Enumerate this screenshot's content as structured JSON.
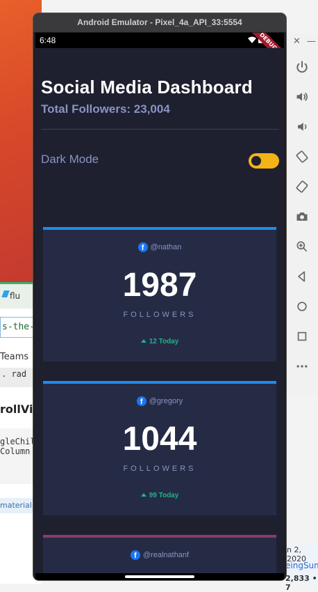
{
  "emulator": {
    "title": "Android Emulator - Pixel_4a_API_33:5554",
    "status_time": "6:48",
    "debug_banner": "DEBUG"
  },
  "dashboard": {
    "title": "Social Media Dashboard",
    "total_followers": "Total Followers: 23,004",
    "dark_mode_label": "Dark Mode",
    "dark_mode_on": true,
    "cards": [
      {
        "network": "facebook",
        "handle": "@nathan",
        "count": "1987",
        "label": "FOLLOWERS",
        "today": "12 Today",
        "accent": "#1d8cf0"
      },
      {
        "network": "facebook",
        "handle": "@gregory",
        "count": "1044",
        "label": "FOLLOWERS",
        "today": "99 Today",
        "accent": "#1d8cf0"
      },
      {
        "network": "facebook",
        "handle": "@realnathanf",
        "accent": "#8c3b6a"
      }
    ]
  },
  "side_toolbar": {
    "buttons": [
      "close-icon",
      "minimize-icon",
      "power-icon",
      "volume-up-icon",
      "volume-down-icon",
      "rotate-left-icon",
      "rotate-right-icon",
      "camera-icon",
      "zoom-icon",
      "back-icon",
      "home-icon",
      "overview-icon",
      "more-icon"
    ]
  },
  "background": {
    "vscode_tab": "flu",
    "path_fragment": "s-the-d",
    "teams": "Teams",
    "gray_strip": ". rad",
    "heading_fragment": "rollView",
    "code_line1": "gleChil",
    "code_line2": "Column",
    "tag_fragment": "material-",
    "date_fragment": "n 2, 2020",
    "link_fragment": "eingSum",
    "count_fragment": "2,833 • 7"
  },
  "colors": {
    "app_bg": "#1e2030",
    "card_bg": "#262b45",
    "muted_text": "#8a93c2",
    "positive": "#1db489",
    "toggle_on": "#f2b416",
    "facebook": "#1877f2"
  }
}
